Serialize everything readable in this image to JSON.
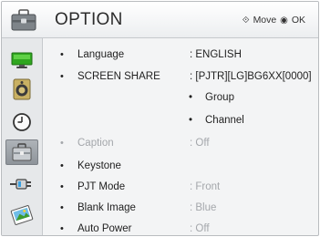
{
  "header": {
    "title": "OPTION",
    "move_glyph": "⟐",
    "move_label": "Move",
    "ok_glyph": "◉",
    "ok_label": "OK",
    "icon": "toolbox-icon"
  },
  "sidebar": {
    "items": [
      {
        "icon": "picture-icon",
        "active": false
      },
      {
        "icon": "audio-icon",
        "active": false
      },
      {
        "icon": "clock-icon",
        "active": false
      },
      {
        "icon": "option-toolbox-icon",
        "active": true
      },
      {
        "icon": "input-plug-icon",
        "active": false
      },
      {
        "icon": "media-photo-icon",
        "active": false
      }
    ]
  },
  "menu": {
    "bullet": "•",
    "language": {
      "label": "Language",
      "value": ": ENGLISH"
    },
    "screen_share": {
      "label": "SCREEN SHARE",
      "value": ": [PJTR][LG]BG6XX[0000]",
      "sub_items": [
        "Group",
        "Channel"
      ]
    },
    "caption": {
      "label": "Caption",
      "value": ": Off"
    },
    "keystone": {
      "label": "Keystone"
    },
    "pjt_mode": {
      "label": "PJT Mode",
      "value": ": Front"
    },
    "blank_image": {
      "label": "Blank Image",
      "value": ": Blue"
    },
    "auto_power": {
      "label": "Auto Power",
      "value": ": Off"
    }
  }
}
